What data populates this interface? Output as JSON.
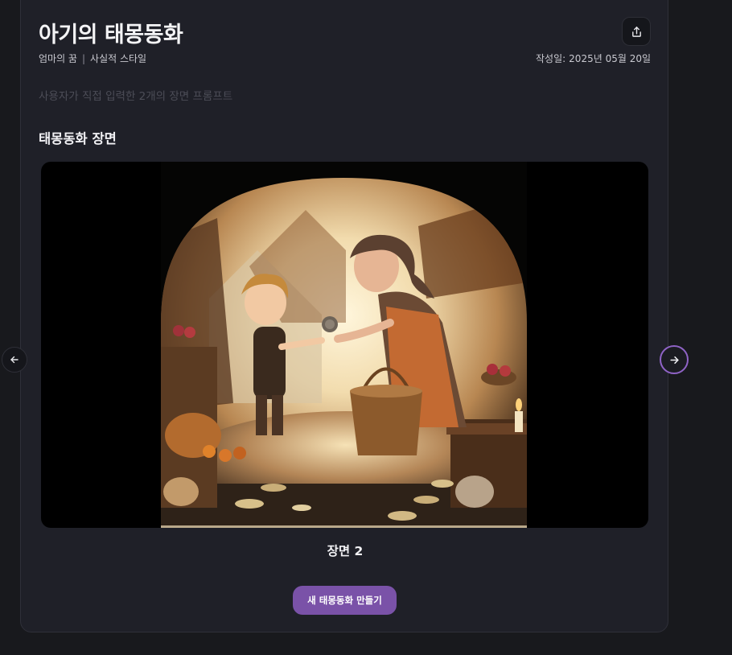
{
  "story": {
    "title": "아기의 태몽동화",
    "dreamer": "엄마의 꿈",
    "separator": "|",
    "style": "사실적 스타일",
    "created_label": "작성일:",
    "created_date": "2025년 05월 20일",
    "subtitle": "사용자가 직접 입력한 2개의 장면 프롬프트"
  },
  "scenes": {
    "section_title": "태몽동화 장면",
    "current_caption": "장면 2",
    "image_alt": "A young boy receiving a coin from an older woman at a warm, candle-lit village market"
  },
  "actions": {
    "new_story_label": "새 태몽동화 만들기",
    "share_icon": "share-icon",
    "prev_icon": "arrow-left-icon",
    "next_icon": "arrow-right-icon"
  },
  "colors": {
    "accent": "#7a52a8",
    "next_ring": "#8f63c6",
    "card_bg": "#1f2028",
    "page_bg": "#18191d"
  }
}
